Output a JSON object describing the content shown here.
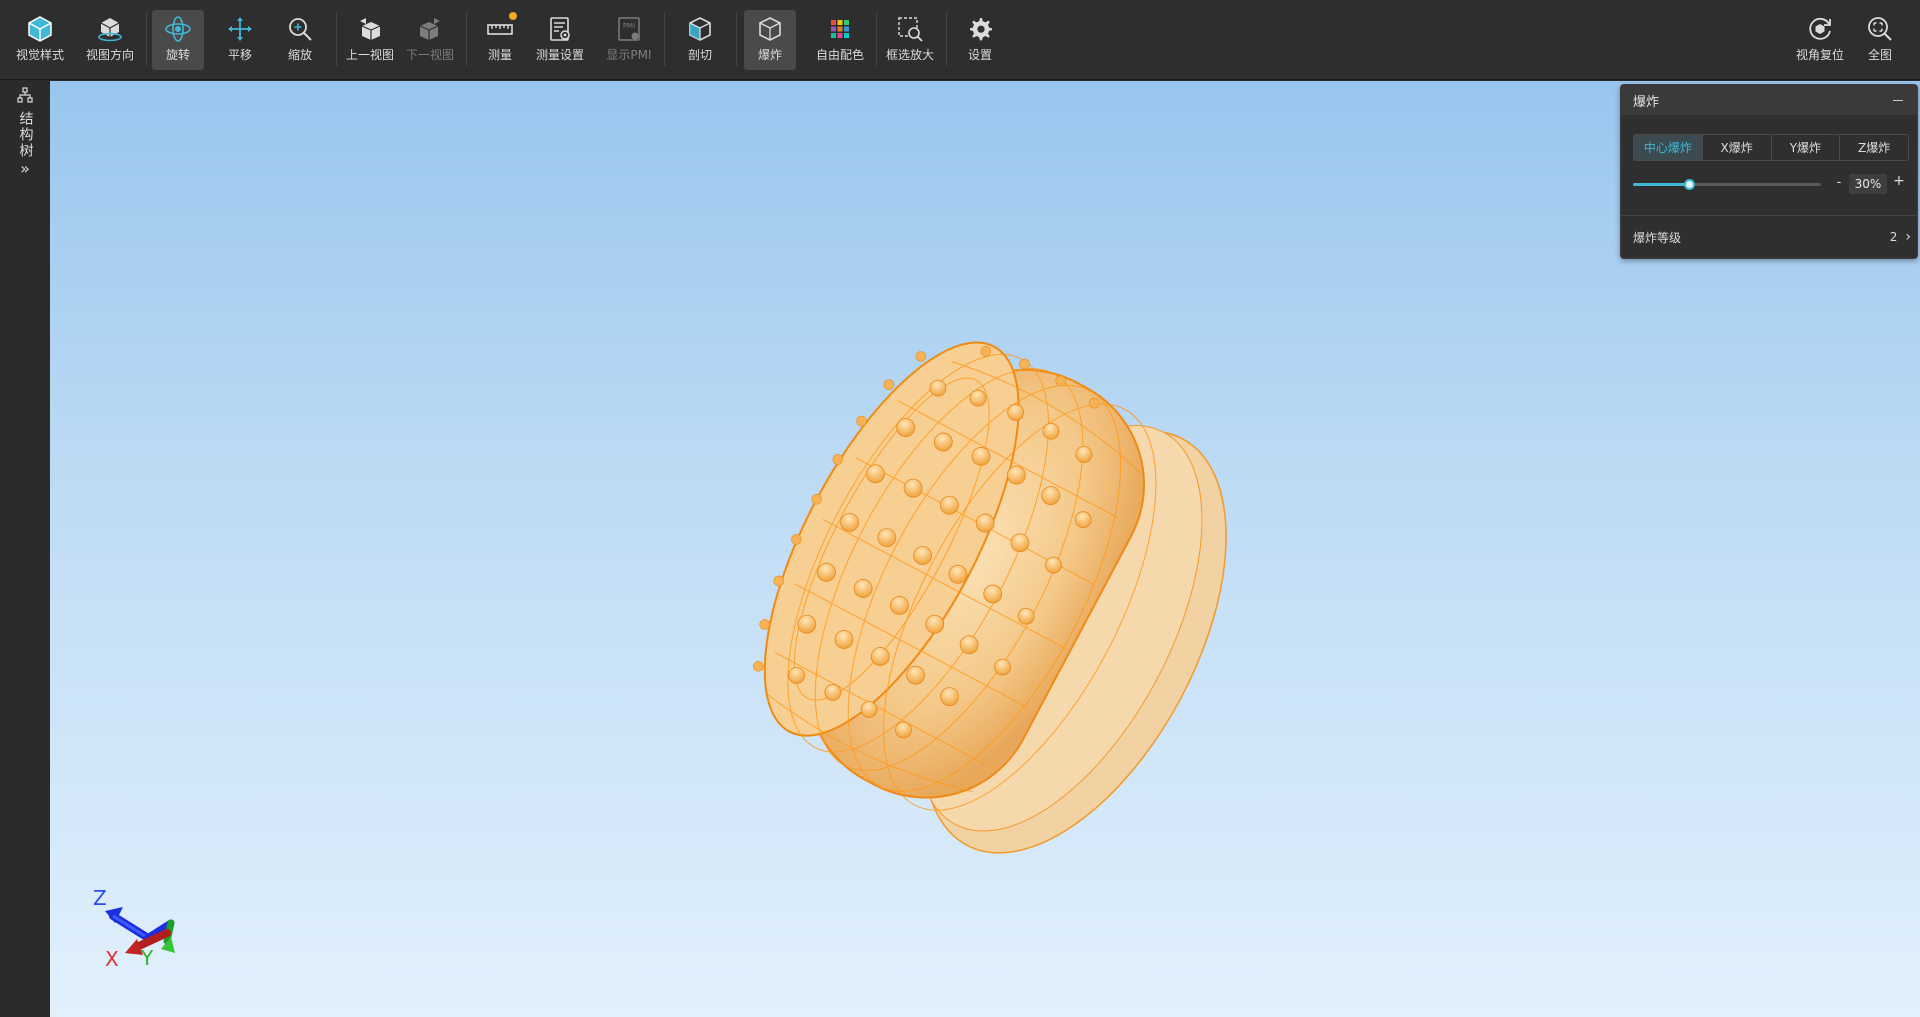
{
  "toolbar": {
    "items": [
      {
        "label": "视觉样式",
        "icon": "visual-style-icon"
      },
      {
        "label": "视图方向",
        "icon": "view-direction-icon"
      },
      {
        "label": "旋转",
        "icon": "rotate-icon",
        "active": true
      },
      {
        "label": "平移",
        "icon": "pan-icon"
      },
      {
        "label": "缩放",
        "icon": "zoom-icon"
      },
      {
        "label": "上一视图",
        "icon": "previous-view-icon"
      },
      {
        "label": "下一视图",
        "icon": "next-view-icon",
        "disabled": true
      },
      {
        "label": "测量",
        "icon": "measure-icon",
        "badge": true
      },
      {
        "label": "测量设置",
        "icon": "measure-settings-icon"
      },
      {
        "label": "显示PMI",
        "icon": "show-pmi-icon",
        "disabled": true
      },
      {
        "label": "剖切",
        "icon": "section-icon"
      },
      {
        "label": "爆炸",
        "icon": "explode-icon",
        "active": true
      },
      {
        "label": "自由配色",
        "icon": "color-palette-icon"
      },
      {
        "label": "框选放大",
        "icon": "box-zoom-icon"
      },
      {
        "label": "设置",
        "icon": "gear-icon"
      }
    ],
    "right_items": [
      {
        "label": "视角复位",
        "icon": "reset-view-icon"
      },
      {
        "label": "全图",
        "icon": "fit-all-icon"
      }
    ],
    "pmi_icon_text": "PMI"
  },
  "left_rail": {
    "structure_tree_label": "结构树",
    "expand_glyph": "»"
  },
  "explode_panel": {
    "title": "爆炸",
    "tabs": [
      "中心爆炸",
      "X爆炸",
      "Y爆炸",
      "Z爆炸"
    ],
    "active_tab": "中心爆炸",
    "slider_percent": 30,
    "value_text": "30%",
    "minus": "-",
    "plus": "+",
    "level_label": "爆炸等级",
    "level_value": "2",
    "chevron": "›"
  },
  "axis_triad": {
    "z_label": "Z",
    "x_label": "X",
    "y_label": "Y"
  },
  "colors": {
    "accent": "#3fb8d6",
    "model_wire": "#ff9a1a",
    "model_fill": "#f3c98d",
    "toolbar_bg": "#2e2e2e"
  }
}
